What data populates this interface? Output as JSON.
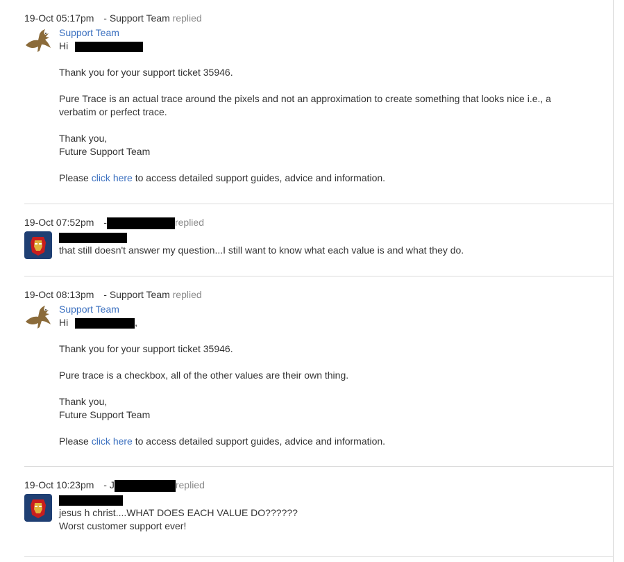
{
  "messages": [
    {
      "datetime": "19-Oct 05:17pm",
      "sender": "- Support Team",
      "replied": "replied",
      "author": "Support Team",
      "greeting": "Hi",
      "ticket_line": "Thank you for your support ticket 35946.",
      "paragraph_1": "Pure Trace is an actual trace around the pixels and not an approximation to create something that looks nice i.e., a",
      "paragraph_2": "verbatim or perfect trace.",
      "signoff_1": "Thank you,",
      "signoff_2": "Future Support Team",
      "footer_pre": "Please",
      "footer_link": "click here",
      "footer_post": "to access detailed support guides, advice and information."
    },
    {
      "datetime": "19-Oct 07:52pm",
      "sender": "-",
      "replied": "replied",
      "line_1": "that still doesn't answer my question...I still want to know what each value is and what they do."
    },
    {
      "datetime": "19-Oct 08:13pm",
      "sender": "- Support Team",
      "replied": "replied",
      "author": "Support Team",
      "greeting": "Hi",
      "greeting_suffix": ",",
      "ticket_line": "Thank you for your support ticket 35946.",
      "paragraph_1": "Pure trace is a checkbox, all of the other values are their own thing.",
      "signoff_1": "Thank you,",
      "signoff_2": "Future Support Team",
      "footer_pre": "Please",
      "footer_link": "click here",
      "footer_post": "to access detailed support guides, advice and information."
    },
    {
      "datetime": "19-Oct 10:23pm",
      "sender": "- J",
      "replied": "replied",
      "line_1": "jesus h christ....WHAT DOES EACH VALUE DO??????",
      "line_2": "Worst customer support ever!"
    }
  ],
  "icons": {
    "support_avatar": "eagle-icon",
    "customer_avatar": "ironman-icon"
  },
  "colors": {
    "link": "#3a6fbf",
    "muted": "#8a8a8a",
    "redaction": "#000000"
  }
}
